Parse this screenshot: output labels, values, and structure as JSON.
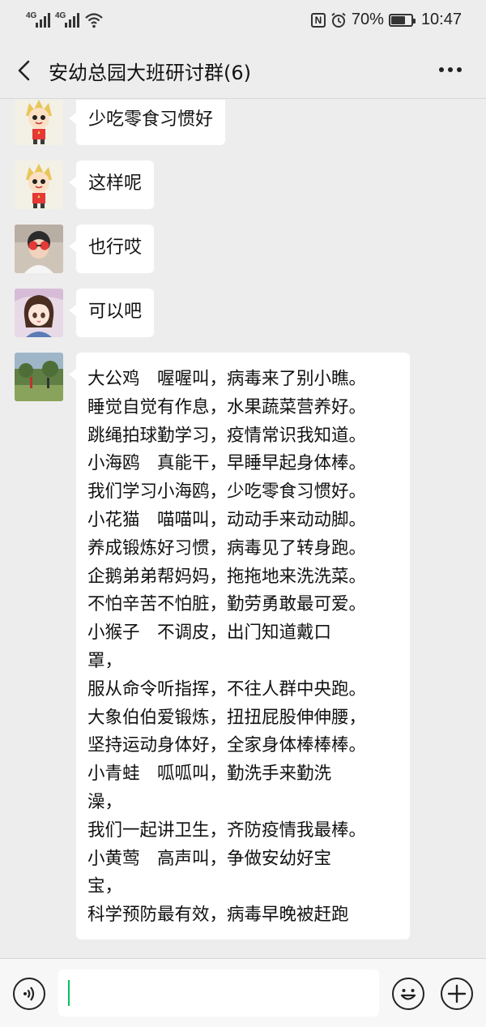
{
  "status_bar": {
    "signal_1": "4G",
    "signal_2": "4G",
    "battery_percent": "70%",
    "time": "10:47",
    "icons": [
      "signal-icon",
      "wifi-icon",
      "nfc-icon",
      "alarm-icon",
      "battery-icon"
    ]
  },
  "header": {
    "title": "安幼总园大班研讨群(6)",
    "icons": [
      "back-arrow-icon",
      "more-icon"
    ]
  },
  "messages": [
    {
      "avatar": "cartoon-boy-avatar",
      "text": "少吃零食习惯好"
    },
    {
      "avatar": "cartoon-boy-avatar",
      "text": "这样呢"
    },
    {
      "avatar": "child-photo-avatar",
      "text": "也行哎"
    },
    {
      "avatar": "anime-girl-avatar",
      "text": "可以吧"
    },
    {
      "avatar": "outdoor-photo-avatar",
      "lines": [
        "大公鸡　喔喔叫，病毒来了别小瞧。",
        "睡觉自觉有作息，水果蔬菜营养好。",
        "跳绳拍球勤学习，疫情常识我知道。",
        "小海鸥　真能干，早睡早起身体棒。",
        "我们学习小海鸥，少吃零食习惯好。",
        "小花猫　喵喵叫，动动手来动动脚。",
        "养成锻炼好习惯，病毒见了转身跑。",
        "企鹅弟弟帮妈妈，拖拖地来洗洗菜。",
        "不怕辛苦不怕脏，勤劳勇敢最可爱。",
        "小猴子　不调皮，出门知道戴口",
        "罩，",
        "服从命令听指挥，不往人群中央跑。",
        "大象伯伯爱锻炼，扭扭屁股伸伸腰，",
        "坚持运动身体好，全家身体棒棒棒。",
        "小青蛙　呱呱叫，勤洗手来勤洗",
        "澡，",
        "我们一起讲卫生，齐防疫情我最棒。",
        "小黄莺　高声叫，争做安幼好宝",
        "宝，",
        "科学预防最有效，病毒早晚被赶跑"
      ]
    }
  ],
  "input_bar": {
    "icons": [
      "voice-icon",
      "emoji-icon",
      "plus-icon"
    ],
    "caret_color": "#07c160"
  }
}
